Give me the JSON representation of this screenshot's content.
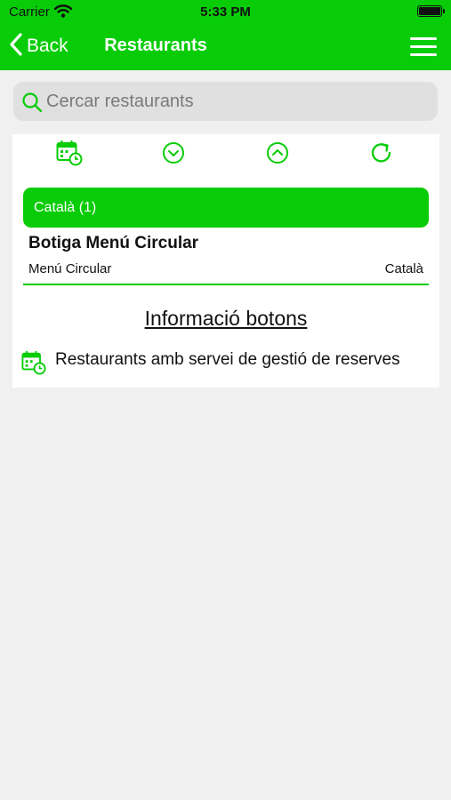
{
  "status_bar": {
    "carrier": "Carrier",
    "time": "5:33 PM"
  },
  "nav": {
    "back_label": "Back",
    "title": "Restaurants"
  },
  "search": {
    "placeholder": "Cercar restaurants",
    "value": ""
  },
  "toolbar": {
    "buttons": [
      {
        "icon": "calendar-clock-icon"
      },
      {
        "icon": "chevron-down-circle-icon"
      },
      {
        "icon": "chevron-up-circle-icon"
      },
      {
        "icon": "refresh-icon"
      }
    ]
  },
  "groups": [
    {
      "label": "Català (1)",
      "restaurants": [
        {
          "name": "Botiga Menú Circular",
          "menu": "Menú Circular",
          "language": "Català"
        }
      ]
    }
  ],
  "info": {
    "heading": "Informació botons",
    "legend": [
      {
        "icon": "calendar-clock-icon",
        "text": "Restaurants amb servei de gestió de reserves"
      }
    ]
  },
  "colors": {
    "accent": "#08cc08",
    "background": "#f0f0f0",
    "search_bg": "#e0e0e0"
  }
}
